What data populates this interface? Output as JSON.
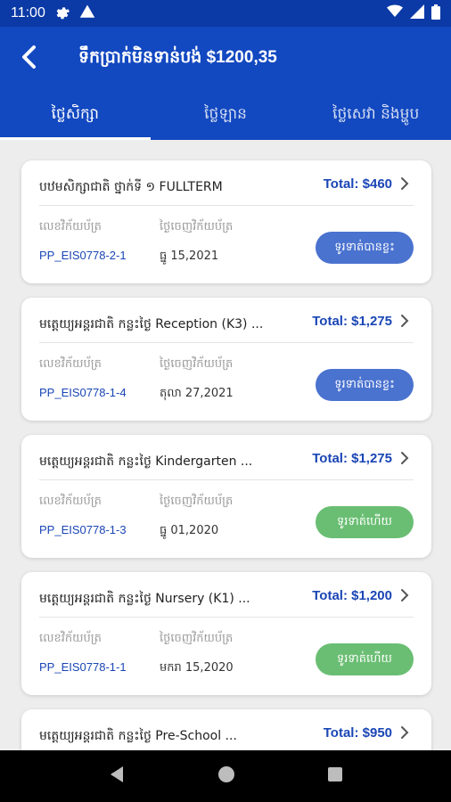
{
  "status_bar": {
    "time": "11:00",
    "icons": [
      "gear-icon",
      "warning-icon",
      "wifi-icon",
      "signal-icon",
      "battery-icon"
    ]
  },
  "header": {
    "title": "ទឹកប្រាក់មិនទាន់បង់ $1200,35",
    "back_icon": "back-arrow-icon"
  },
  "tabs": [
    {
      "label": "ថ្លៃសិក្សា",
      "active": true
    },
    {
      "label": "ថ្លៃឡាន",
      "active": false
    },
    {
      "label": "ថ្លៃសេវា និងម្ហូប",
      "active": false
    }
  ],
  "cards": [
    {
      "title": "បឋមសិក្សាជាតិ ថ្នាក់ទី ១ FULLTERM",
      "total": "Total: $460",
      "invoice_label": "លេខវិក័យប័ត្រ",
      "invoice": "PP_EIS0778-2-1",
      "date_label": "ថ្ងៃចេញវិក័យប័ត្រ",
      "date": "ធ្នូ 15,2021",
      "status": "ទូរទាត់បានខ្លះ",
      "status_type": "partial"
    },
    {
      "title": "មត្តេយ្យអន្តរជាតិ កន្លះថ្ងៃ Reception (K3) ...",
      "total": "Total: $1,275",
      "invoice_label": "លេខវិក័យប័ត្រ",
      "invoice": "PP_EIS0778-1-4",
      "date_label": "ថ្ងៃចេញវិក័យប័ត្រ",
      "date": "តុលា 27,2021",
      "status": "ទូរទាត់បានខ្លះ",
      "status_type": "partial"
    },
    {
      "title": "មត្តេយ្យអន្តរជាតិ កន្លះថ្ងៃ Kindergarten ...",
      "total": "Total: $1,275",
      "invoice_label": "លេខវិក័យប័ត្រ",
      "invoice": "PP_EIS0778-1-3",
      "date_label": "ថ្ងៃចេញវិក័យប័ត្រ",
      "date": "ធ្នូ 01,2020",
      "status": "ទូរទាត់ហើយ",
      "status_type": "paid"
    },
    {
      "title": "មត្តេយ្យអន្តរជាតិ កន្លះថ្ងៃ Nursery (K1) ...",
      "total": "Total: $1,200",
      "invoice_label": "លេខវិក័យប័ត្រ",
      "invoice": "PP_EIS0778-1-1",
      "date_label": "ថ្ងៃចេញវិក័យប័ត្រ",
      "date": "មករា 15,2020",
      "status": "ទូរទាត់ហើយ",
      "status_type": "paid"
    },
    {
      "title": "មត្តេយ្យអន្តរជាតិ កន្លះថ្ងៃ Pre-School ...",
      "total": "Total: $950",
      "invoice_label": "",
      "invoice": "",
      "date_label": "",
      "date": "",
      "status": "",
      "status_type": ""
    }
  ],
  "nav_bar": {
    "icons": [
      "nav-back-icon",
      "nav-home-icon",
      "nav-recents-icon"
    ]
  },
  "colors": {
    "primary": "#1248c0",
    "status_bar": "#0b3aa6",
    "accent_text": "#1a46b5",
    "partial": "#4a72cf",
    "paid": "#6abe73",
    "background": "#ededed"
  }
}
